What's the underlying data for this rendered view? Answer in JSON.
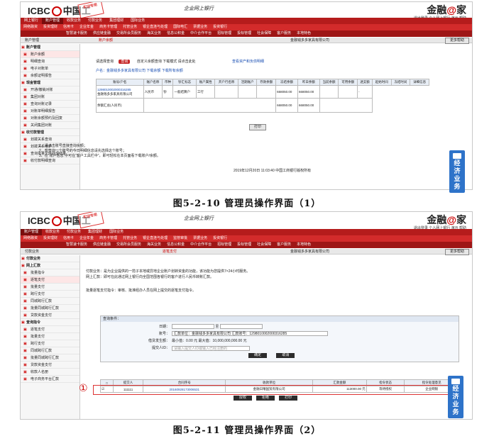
{
  "shot1": {
    "logo": "ICBC",
    "logo_cn": "中国工",
    "ctitle": "企业网上银行",
    "brand_a": "金融",
    "brand_at": "@",
    "brand_b": "家",
    "toplinks": "退出登录  个人网上银行  演示  帮助",
    "nav1": [
      "网上银行",
      "账户管理",
      "收款业务",
      "付款业务",
      "集团理财",
      "国际业务"
    ],
    "nav2": [
      "网络融资",
      "投资理财",
      "信用卡",
      "企业年金",
      "商务卡管理",
      "托管业务",
      "银企直连与处理",
      "国际电汇",
      "票据业务",
      "投资银行"
    ],
    "nav3": [
      "智慧速卡服务",
      "供应链金融",
      "交易所会员服务",
      "海关业务",
      "信息公积金",
      "中介合作平台",
      "招标管理",
      "投标管理",
      "社会保障",
      "客户服务",
      "本地特色"
    ],
    "bar_left": "账户管理",
    "bar_mid": "账户余额",
    "bar_company": "金融钱多多家具有限公司",
    "bar_btn": "更多帮助",
    "side": [
      {
        "t": "账户管理",
        "grp": true
      },
      {
        "t": "账户余额",
        "sel": true
      },
      {
        "t": "明细查询"
      },
      {
        "t": "电子对账单"
      },
      {
        "t": "余额证明报告"
      },
      {
        "t": "现金管理",
        "grp": true
      },
      {
        "t": "开通/撤销对账"
      },
      {
        "t": "集团对账"
      },
      {
        "t": "查询对账记录"
      },
      {
        "t": "对账单明细报告"
      },
      {
        "t": "对账余额预约及回复"
      },
      {
        "t": "关闭集团对账"
      },
      {
        "t": "收付款管理",
        "grp": true
      },
      {
        "t": "划拨关系查询"
      },
      {
        "t": "划拨关系维护"
      },
      {
        "t": "查询批量文件处理结果"
      },
      {
        "t": "收付款明细查询"
      }
    ],
    "query_label": "请选择查询",
    "query_btn": "查询",
    "query_opts": "自定义余额查询  下载模式 请点击此处",
    "query_link": "查看资产和负债明细",
    "owner": "户名：金融钱多多家具有限公司 下载余额 下载所有余额",
    "cols": [
      "账号/户名",
      "账户名称",
      "币种",
      "钞汇标志",
      "账户属性",
      "开户行名称",
      "活期账户",
      "存款余额",
      "冻结余额",
      "昨日余额",
      "当前余额",
      "可用余额",
      "透支额",
      "起始时间",
      "冻结时间",
      "详细信息"
    ],
    "row_acct": "1298010002000316285",
    "row_name": "金融钱多多家具有限公司",
    "row_cur": "人民币",
    "row_flag": "钞",
    "row_attr": "一般结算户",
    "row_bank": "工行",
    "row_bal1": "668050.00",
    "row_bal2": "668050.00",
    "row_dash": "-",
    "sum_label": "余额汇总(人民币)",
    "sum1": "668050.00",
    "sum2": "668050.00",
    "print_btn": "打印",
    "notes": [
      "1、请点击账号直接查询余额；",
      "2、想查询一个账号的今日明细信息请先选择这个账号；",
      "3、在“账户信息”中可在“客户工具栏中”，即可轻松在本页面看下载账户/余额。"
    ],
    "footer": "2019年12月20日 11:03:40 中国工商银行版权所有",
    "econ": "经济业务"
  },
  "cap1": "图5-2-10 管理员操作界面（1）",
  "shot2": {
    "logo": "ICBC",
    "logo_cn": "中国工",
    "ctitle": "企业网上银行",
    "brand_a": "金融",
    "brand_at": "@",
    "brand_b": "家",
    "toplinks": "退出登录  个人网上银行  演示  帮助",
    "nav1": [
      "账户管理",
      "收款业务",
      "付款业务",
      "集团理财",
      "国际业务"
    ],
    "nav2": [
      "网络融资",
      "投资理财",
      "信用卡",
      "企业年金",
      "商务卡管理",
      "托管业务",
      "银企直连与处理",
      "监管审批",
      "票据业务",
      "投资银行"
    ],
    "nav3": [
      "智慧速卡服务",
      "供应链金融",
      "交易所会员服务",
      "海关业务",
      "信息公积金",
      "中介合作平台",
      "招标管理",
      "投标管理",
      "社会保障",
      "客户服务",
      "本地特色"
    ],
    "bar_left": "付款业务",
    "bar_mid": "逐笔支付",
    "bar_company": "金融钱多多家具有限公司",
    "bar_btn": "更多帮助",
    "side": [
      {
        "t": "付款业务",
        "grp": true
      },
      {
        "t": "网上汇款",
        "grp": true
      },
      {
        "t": "批量指令"
      },
      {
        "t": "逐笔支付",
        "sel": true
      },
      {
        "t": "批量支付"
      },
      {
        "t": "跨行支付"
      },
      {
        "t": "同城跨行汇款"
      },
      {
        "t": "批量同城跨行汇款"
      },
      {
        "t": "贷款资金支付"
      },
      {
        "t": "查询指令",
        "grp": true
      },
      {
        "t": "逐笔支付"
      },
      {
        "t": "批量支付"
      },
      {
        "t": "跨行支付"
      },
      {
        "t": "同城跨行汇款"
      },
      {
        "t": "批量同城跨行汇款"
      },
      {
        "t": "贷款资金支付"
      },
      {
        "t": "收款人名册"
      },
      {
        "t": "电子商务平台汇款"
      }
    ],
    "intro1": "付款业务：是为企业提供的一揽子本地或异地企业账户划转资金的功能，该功能为您提供7×24小时服务。",
    "intro2": "网上汇款：即可在此通过网上银行向全国范围各银行的客户进行人民币转账汇款。",
    "intro3": "批量逐笔支付指令：审核、批准经办人员在网上提交的逐笔支付指令。",
    "qcond": "查询条件：",
    "f_date": "日期：",
    "f_to": "至",
    "f_acct": "账号：",
    "f_acct_v": "汇款单位：金融钱多多家具有限公司  汇款账号：1298010002000316285",
    "f_amt": "借贷发生额：",
    "f_amt_v": "最小值：0.00         元 最大值：10,000,000,000.00 元",
    "f_id": "提交人ID：",
    "f_id_ph": "请输入提交人ID或输入已经注册的",
    "btn_ok": "确定",
    "btn_cancel": "取消",
    "t_cols": [
      "提交人",
      "合同序号",
      "收款单位",
      "汇款金额",
      "指令状态",
      "指令处理意见"
    ],
    "t_row": [
      "111111",
      "20160928173006531",
      "金融日曜国贸有限公司",
      "113000.00 元",
      "等待授权",
      "企业网银"
    ],
    "b_btns": [
      "授权",
      "拒绝",
      "打印"
    ],
    "circle": "①",
    "econ": "经济业务",
    "stamp": "COPY"
  },
  "cap2": "图5-2-11 管理员操作界面（2）",
  "colors": {
    "red": "#b51c1c",
    "blue": "#2e73c9",
    "link": "#1a4fb3"
  }
}
